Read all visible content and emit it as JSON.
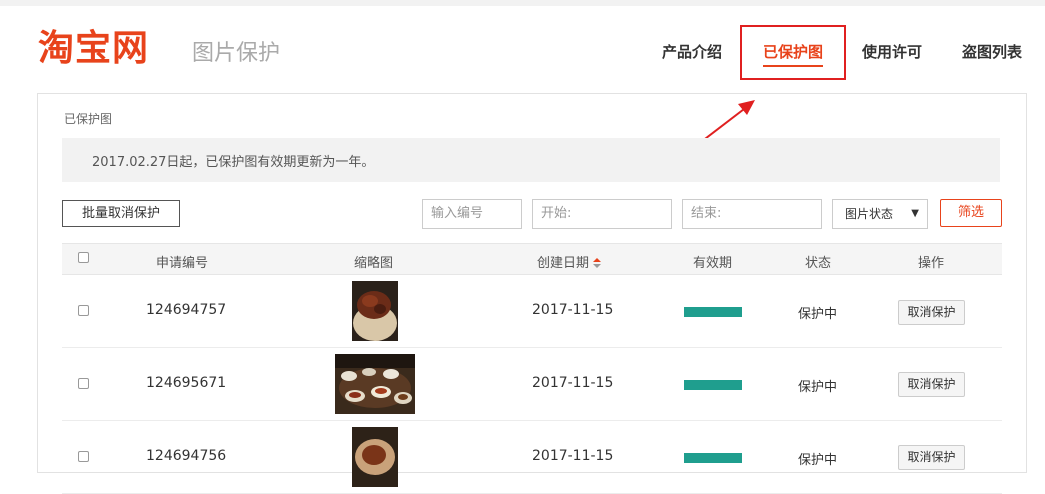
{
  "header": {
    "logo_text": "淘宝网",
    "subtitle": "图片保护",
    "nav": [
      "产品介绍",
      "已保护图",
      "使用许可",
      "盗图列表"
    ],
    "active_nav_index": 1
  },
  "breadcrumb": "已保护图",
  "notice": "2017.02.27日起，已保护图有效期更新为一年。",
  "toolbar": {
    "bulk_cancel_label": "批量取消保护",
    "id_placeholder": "输入编号",
    "start_placeholder": "开始:",
    "end_placeholder": "结束:",
    "status_select": "图片状态",
    "filter_label": "筛选"
  },
  "table": {
    "columns": [
      "申请编号",
      "缩略图",
      "创建日期",
      "有效期",
      "状态",
      "操作"
    ],
    "rows": [
      {
        "id": "124694757",
        "date": "2017-11-15",
        "validity": 1.0,
        "status": "保护中",
        "action": "取消保护"
      },
      {
        "id": "124695671",
        "date": "2017-11-15",
        "validity": 1.0,
        "status": "保护中",
        "action": "取消保护"
      },
      {
        "id": "124694756",
        "date": "2017-11-15",
        "validity": 1.0,
        "status": "保护中",
        "action": "取消保护"
      }
    ]
  },
  "colors": {
    "brand": "#e8431b",
    "validity_bar": "#1f9e8e",
    "highlight": "#e02020"
  }
}
